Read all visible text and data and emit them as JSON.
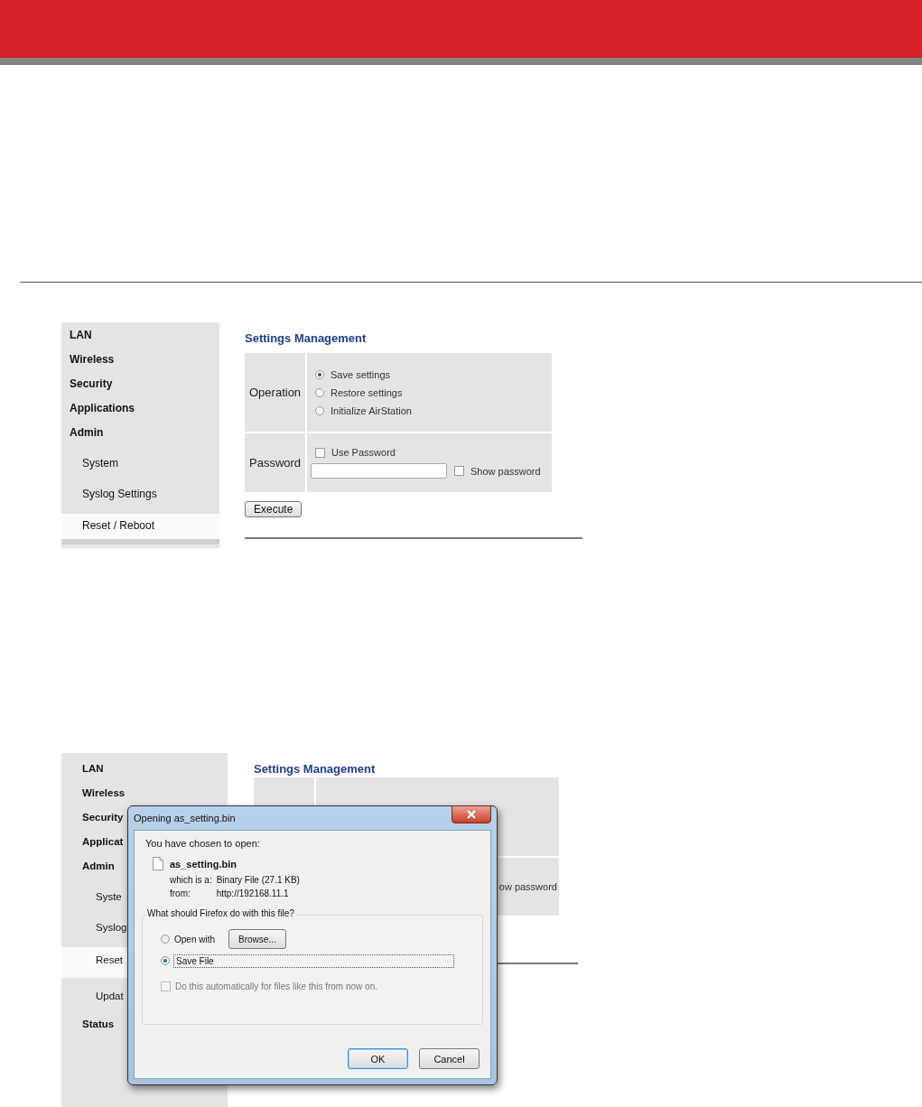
{
  "first_screen": {
    "sidebar": [
      {
        "label": "LAN",
        "kind": "section",
        "selected": false
      },
      {
        "label": "Wireless",
        "kind": "section",
        "selected": false
      },
      {
        "label": "Security",
        "kind": "section",
        "selected": false
      },
      {
        "label": "Applications",
        "kind": "section",
        "selected": false
      },
      {
        "label": "Admin",
        "kind": "section",
        "selected": false
      },
      {
        "label": "System",
        "kind": "sub",
        "selected": false
      },
      {
        "label": "Syslog Settings",
        "kind": "sub",
        "selected": false
      },
      {
        "label": "Reset / Reboot",
        "kind": "sub",
        "selected": true
      }
    ],
    "title": "Settings Management",
    "operation_label": "Operation",
    "operations": [
      {
        "label": "Save settings",
        "selected": true
      },
      {
        "label": "Restore settings",
        "selected": false
      },
      {
        "label": "Initialize AirStation",
        "selected": false
      }
    ],
    "password_label": "Password",
    "use_password": {
      "label": "Use Password",
      "checked": false
    },
    "show_password": {
      "label": "Show password",
      "checked": false
    },
    "button": "Execute"
  },
  "second_screen": {
    "sidebar": [
      {
        "label": "LAN",
        "kind": "section",
        "selected": false
      },
      {
        "label": "Wireless",
        "kind": "section",
        "selected": false
      },
      {
        "label": "Security",
        "kind": "section",
        "selected": false
      },
      {
        "label": "Applicat",
        "kind": "section",
        "selected": false
      },
      {
        "label": "Admin",
        "kind": "section",
        "selected": false
      },
      {
        "label": "Syste",
        "kind": "sub",
        "selected": false
      },
      {
        "label": "Syslog",
        "kind": "sub",
        "selected": false
      },
      {
        "label": "Reset",
        "kind": "sub",
        "selected": true
      },
      {
        "label": "Updat",
        "kind": "sub",
        "selected": false
      },
      {
        "label": "Status",
        "kind": "section",
        "selected": false
      }
    ],
    "title": "Settings Management",
    "show_password_fragment": "ow password"
  },
  "dialog": {
    "title": "Opening as_setting.bin",
    "intro": "You have chosen to open:",
    "file_name": "as_setting.bin",
    "type_label": "which is a:",
    "type_value": "Binary File (27.1 KB)",
    "from_label": "from:",
    "from_value": "http://192168.11.1",
    "question": "What should Firefox do with this file?",
    "choices": [
      {
        "label": "Open with",
        "selected": false,
        "kind": "browse",
        "button": "Browse..."
      },
      {
        "label": "Save File",
        "selected": true,
        "kind": "plain"
      }
    ],
    "auto": {
      "label": "Do this automatically for files like this from now on.",
      "checked": false,
      "disabled": true
    },
    "buttons": [
      {
        "label": "OK",
        "kind": "default"
      },
      {
        "label": "Cancel",
        "kind": "normal"
      }
    ]
  }
}
